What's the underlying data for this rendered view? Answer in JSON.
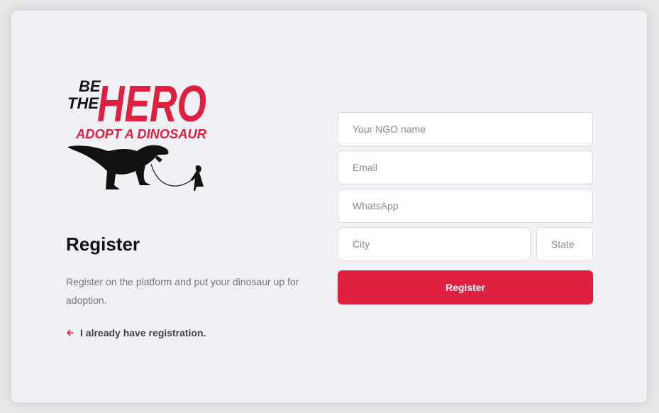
{
  "logo": {
    "line1": "BE",
    "line2": "THE",
    "line3": "HERO",
    "tagline": "ADOPT A DINOSAUR"
  },
  "colors": {
    "brand_red": "#e02041",
    "page_bg": "#e7e7ea",
    "card_bg": "#f0f0f5"
  },
  "register": {
    "title": "Register",
    "description": "Register on the platform and put your dinosaur up for adoption.",
    "back_link": "I already have registration.",
    "back_icon": "arrow-left-icon"
  },
  "form": {
    "ngo_name_placeholder": "Your NGO name",
    "email_placeholder": "Email",
    "whatsapp_placeholder": "WhatsApp",
    "city_placeholder": "City",
    "state_placeholder": "State",
    "submit_label": "Register"
  }
}
